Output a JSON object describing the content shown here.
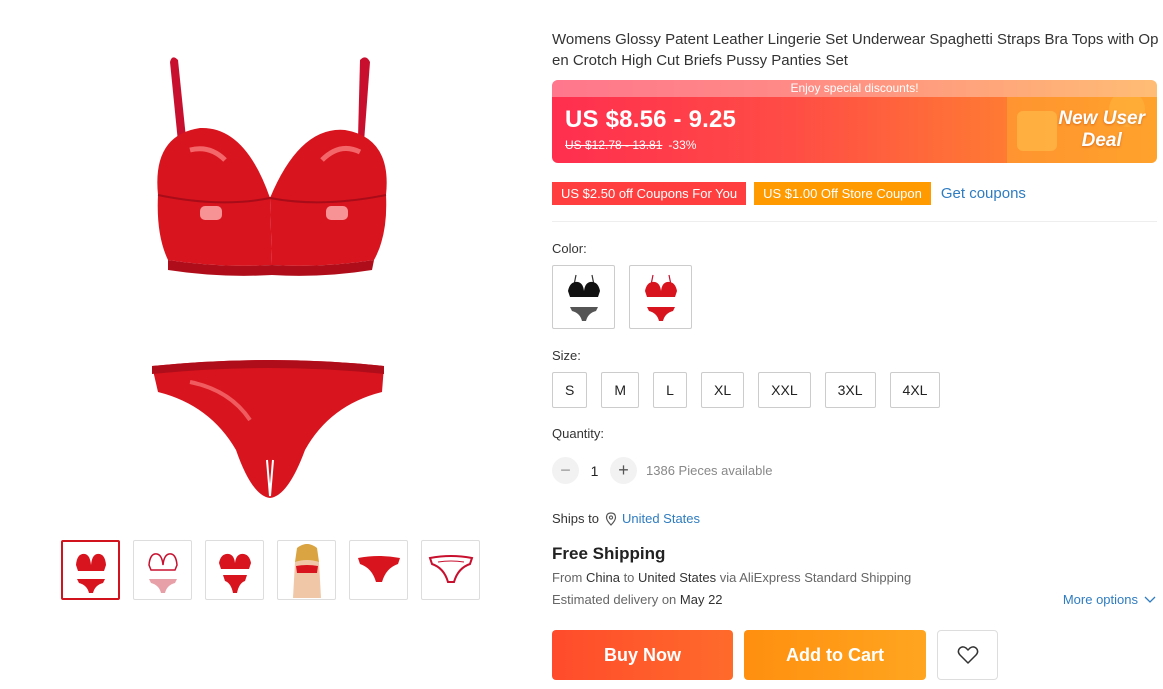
{
  "product": {
    "title": "Womens Glossy Patent Leather Lingerie Set Underwear Spaghetti Straps Bra Tops with Open Crotch High Cut Briefs Pussy Panties Set",
    "main_image_icon": "red-lingerie-set-image",
    "thumbnails": [
      {
        "icon": "red-set-thumb-icon",
        "active": true
      },
      {
        "icon": "lace-set-thumb-icon",
        "active": false
      },
      {
        "icon": "red-set-alt-thumb-icon",
        "active": false
      },
      {
        "icon": "model-thumb-icon",
        "active": false
      },
      {
        "icon": "briefs-front-thumb-icon",
        "active": false
      },
      {
        "icon": "briefs-back-thumb-icon",
        "active": false
      }
    ]
  },
  "price": {
    "banner_caption": "Enjoy special discounts!",
    "current": "US $8.56 - 9.25",
    "original": "US $12.78 - 13.81",
    "discount": "-33%",
    "deal_line1": "New User",
    "deal_line2": "Deal"
  },
  "coupons": {
    "items": [
      "US $2.50 off Coupons For You",
      "US $1.00 Off Store Coupon"
    ],
    "get_label": "Get coupons"
  },
  "color": {
    "label": "Color:",
    "options": [
      {
        "icon": "black-set-swatch-icon"
      },
      {
        "icon": "red-set-swatch-icon"
      }
    ]
  },
  "size": {
    "label": "Size:",
    "options": [
      "S",
      "M",
      "L",
      "XL",
      "XXL",
      "3XL",
      "4XL"
    ]
  },
  "quantity": {
    "label": "Quantity:",
    "minus": "−",
    "value": "1",
    "plus": "+",
    "available": "1386 Pieces available"
  },
  "shipping": {
    "ships_to_label": "Ships to",
    "country": "United States",
    "free_label": "Free Shipping",
    "from_prefix": "From",
    "from_country": "China",
    "to_word": "to",
    "to_country": "United States",
    "via_text": "via AliExpress Standard Shipping",
    "eta_prefix": "Estimated delivery on",
    "eta_date": "May 22",
    "more_options": "More options"
  },
  "actions": {
    "buy_now": "Buy Now",
    "add_to_cart": "Add to Cart"
  },
  "colors": {
    "accent_red": "#ff4b2b",
    "accent_orange": "#ffa51f",
    "link_blue": "#2e7cc1"
  }
}
